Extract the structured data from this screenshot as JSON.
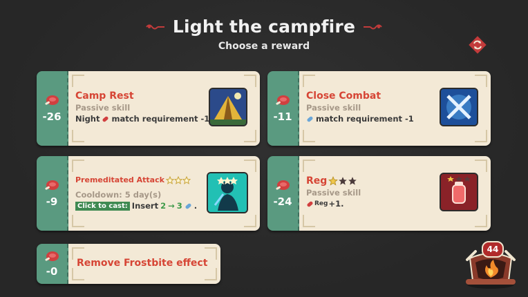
{
  "header": {
    "title": "Light the campfire",
    "subtitle": "Choose a reward"
  },
  "icons": {
    "reroll": "reroll-diamond-icon",
    "cost": "meat-icon"
  },
  "colors": {
    "stub": "#5a9a80",
    "card_body": "#f3e9d6",
    "skill_name": "#d64535",
    "skill_type": "#a69888",
    "accent_red": "#c23b3b"
  },
  "rewards": [
    {
      "cost": "-26",
      "name": "Camp Rest",
      "type": "Passive skill",
      "desc_prefix": "Night",
      "desc_suffix": "match requirement -1",
      "icon": "tent-icon"
    },
    {
      "cost": "-11",
      "name": "Close Combat",
      "type": "Passive skill",
      "desc_suffix": "match requirement -1",
      "icon": "crossed-swords-icon"
    },
    {
      "cost": "-9",
      "name": "Premeditated Attack",
      "stars": 3,
      "cooldown": "Cooldown: 5 day(s)",
      "cast_badge": "Click to cast:",
      "cast_text": "Insert",
      "cast_from": "2",
      "cast_arrow": "→",
      "cast_to": "3",
      "cast_end": ".",
      "icon": "shadow-warrior-icon"
    },
    {
      "cost": "-24",
      "name": "Reg",
      "stars_filled": 1,
      "stars_total": 3,
      "type": "Passive skill",
      "desc_token": "Reg",
      "desc_suffix": "+1.",
      "icon": "potion-jar-icon"
    },
    {
      "cost": "-0",
      "name": "Remove Frostbite effect"
    }
  ],
  "campfire": {
    "count": "44"
  }
}
